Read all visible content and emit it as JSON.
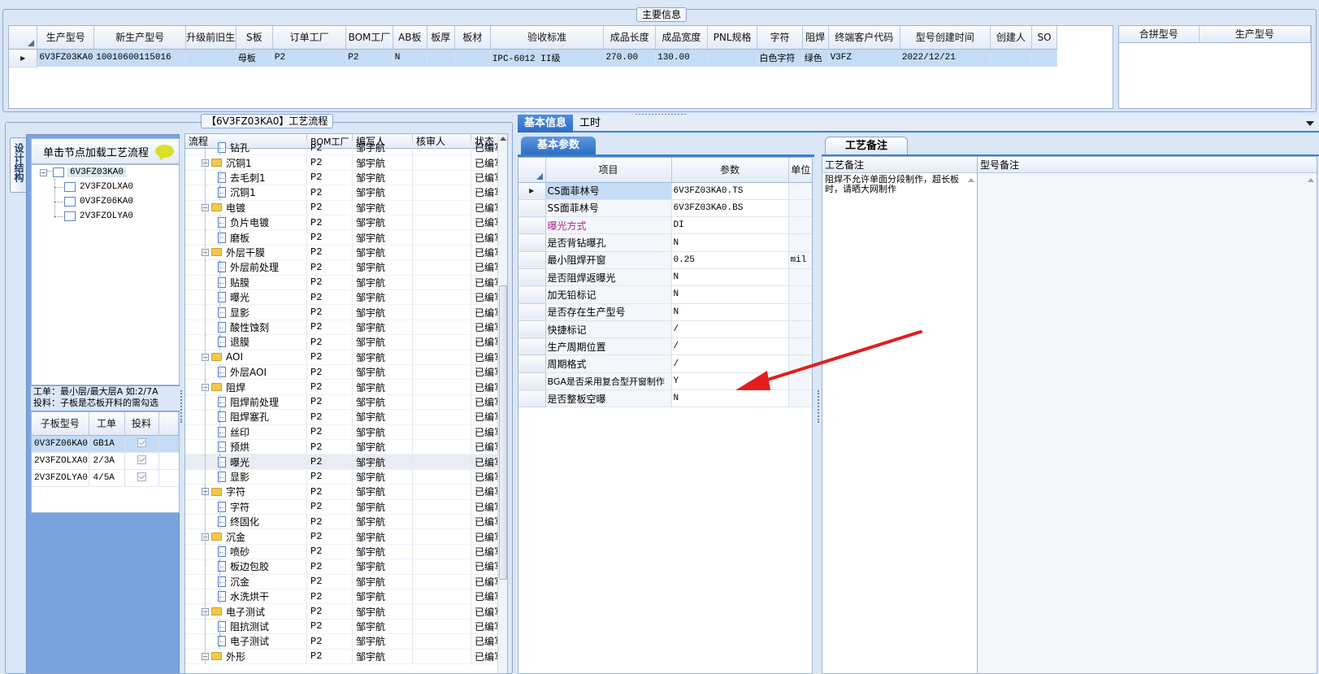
{
  "main_info_title": "主要信息",
  "main_table": {
    "headers": [
      "生产型号",
      "新生产型号",
      "升级前旧生产型号",
      "S板",
      "订单工厂",
      "BOM工厂",
      "AB板",
      "板厚",
      "板材",
      "验收标准",
      "成品长度",
      "成品宽度",
      "PNL规格",
      "字符",
      "阻焊",
      "终端客户代码",
      "型号创建时间",
      "创建人",
      "SO"
    ],
    "row": [
      "6V3FZ03KA0",
      "10010600115016",
      "",
      "母板",
      "P2",
      "P2",
      "N",
      "",
      "",
      "IPC-6012 II级",
      "270.00",
      "130.00",
      "",
      "白色字符",
      "绿色",
      "V3FZ",
      "2022/12/21",
      "",
      ""
    ]
  },
  "merge_table": {
    "headers": [
      "合拼型号",
      "生产型号"
    ]
  },
  "flow_title": "【6V3FZ03KA0】工艺流程",
  "side_tab": "设计结构",
  "structure": {
    "hint": "单击节点加载工艺流程",
    "root": "6V3FZ03KA0",
    "children": [
      "2V3FZOLXA0",
      "0V3FZ06KA0",
      "2V3FZOLYA0"
    ],
    "note1": "工单：最小层/最大层A 如:2/7A",
    "note2": "投料：子板是芯板开料的需勾选",
    "sub_headers": [
      "子板型号",
      "工单",
      "投料"
    ],
    "sub_rows": [
      [
        "0V3FZ06KA0",
        "GB1A"
      ],
      [
        "2V3FZOLXA0",
        "2/3A"
      ],
      [
        "2V3FZOLYA0",
        "4/5A"
      ]
    ]
  },
  "flow": {
    "headers": [
      "流程",
      "BOM工厂",
      "编写人",
      "核审人",
      "状态"
    ],
    "rows": [
      {
        "name": "钻孔",
        "level": 1,
        "folder": false,
        "bom": "P2",
        "writer": "邹宇航",
        "status": "已编写"
      },
      {
        "name": "沉铜1",
        "level": 0,
        "folder": true,
        "bom": "P2",
        "writer": "邹宇航",
        "status": "已编写"
      },
      {
        "name": "去毛刺1",
        "level": 1,
        "folder": false,
        "bom": "P2",
        "writer": "邹宇航",
        "status": "已编写"
      },
      {
        "name": "沉铜1",
        "level": 1,
        "folder": false,
        "bom": "P2",
        "writer": "邹宇航",
        "status": "已编写"
      },
      {
        "name": "电镀",
        "level": 0,
        "folder": true,
        "bom": "P2",
        "writer": "邹宇航",
        "status": "已编写"
      },
      {
        "name": "负片电镀",
        "level": 1,
        "folder": false,
        "bom": "P2",
        "writer": "邹宇航",
        "status": "已编写"
      },
      {
        "name": "磨板",
        "level": 1,
        "folder": false,
        "bom": "P2",
        "writer": "邹宇航",
        "status": "已编写"
      },
      {
        "name": "外层干膜",
        "level": 0,
        "folder": true,
        "bom": "P2",
        "writer": "邹宇航",
        "status": "已编写"
      },
      {
        "name": "外层前处理",
        "level": 1,
        "folder": false,
        "bom": "P2",
        "writer": "邹宇航",
        "status": "已编写"
      },
      {
        "name": "贴膜",
        "level": 1,
        "folder": false,
        "bom": "P2",
        "writer": "邹宇航",
        "status": "已编写"
      },
      {
        "name": "曝光",
        "level": 1,
        "folder": false,
        "bom": "P2",
        "writer": "邹宇航",
        "status": "已编写"
      },
      {
        "name": "显影",
        "level": 1,
        "folder": false,
        "bom": "P2",
        "writer": "邹宇航",
        "status": "已编写"
      },
      {
        "name": "酸性蚀刻",
        "level": 1,
        "folder": false,
        "bom": "P2",
        "writer": "邹宇航",
        "status": "已编写"
      },
      {
        "name": "退膜",
        "level": 1,
        "folder": false,
        "bom": "P2",
        "writer": "邹宇航",
        "status": "已编写"
      },
      {
        "name": "AOI",
        "level": 0,
        "folder": true,
        "bom": "P2",
        "writer": "邹宇航",
        "status": "已编写"
      },
      {
        "name": "外层AOI",
        "level": 1,
        "folder": false,
        "bom": "P2",
        "writer": "邹宇航",
        "status": "已编写"
      },
      {
        "name": "阻焊",
        "level": 0,
        "folder": true,
        "bom": "P2",
        "writer": "邹宇航",
        "status": "已编写"
      },
      {
        "name": "阻焊前处理",
        "level": 1,
        "folder": false,
        "bom": "P2",
        "writer": "邹宇航",
        "status": "已编写"
      },
      {
        "name": "阻焊塞孔",
        "level": 1,
        "folder": false,
        "bom": "P2",
        "writer": "邹宇航",
        "status": "已编写"
      },
      {
        "name": "丝印",
        "level": 1,
        "folder": false,
        "bom": "P2",
        "writer": "邹宇航",
        "status": "已编写"
      },
      {
        "name": "预烘",
        "level": 1,
        "folder": false,
        "bom": "P2",
        "writer": "邹宇航",
        "status": "已编写"
      },
      {
        "name": "曝光",
        "level": 1,
        "folder": false,
        "bom": "P2",
        "writer": "邹宇航",
        "status": "已编写",
        "selected": true
      },
      {
        "name": "显影",
        "level": 1,
        "folder": false,
        "bom": "P2",
        "writer": "邹宇航",
        "status": "已编写"
      },
      {
        "name": "字符",
        "level": 0,
        "folder": true,
        "bom": "P2",
        "writer": "邹宇航",
        "status": "已编写"
      },
      {
        "name": "字符",
        "level": 1,
        "folder": false,
        "bom": "P2",
        "writer": "邹宇航",
        "status": "已编写"
      },
      {
        "name": "终固化",
        "level": 1,
        "folder": false,
        "bom": "P2",
        "writer": "邹宇航",
        "status": "已编写"
      },
      {
        "name": "沉金",
        "level": 0,
        "folder": true,
        "bom": "P2",
        "writer": "邹宇航",
        "status": "已编写"
      },
      {
        "name": "喷砂",
        "level": 1,
        "folder": false,
        "bom": "P2",
        "writer": "邹宇航",
        "status": "已编写"
      },
      {
        "name": "板边包胶",
        "level": 1,
        "folder": false,
        "bom": "P2",
        "writer": "邹宇航",
        "status": "已编写"
      },
      {
        "name": "沉金",
        "level": 1,
        "folder": false,
        "bom": "P2",
        "writer": "邹宇航",
        "status": "已编写"
      },
      {
        "name": "水洗烘干",
        "level": 1,
        "folder": false,
        "bom": "P2",
        "writer": "邹宇航",
        "status": "已编写"
      },
      {
        "name": "电子测试",
        "level": 0,
        "folder": true,
        "bom": "P2",
        "writer": "邹宇航",
        "status": "已编写"
      },
      {
        "name": "阻抗测试",
        "level": 1,
        "folder": false,
        "bom": "P2",
        "writer": "邹宇航",
        "status": "已编写"
      },
      {
        "name": "电子测试",
        "level": 1,
        "folder": false,
        "bom": "P2",
        "writer": "邹宇航",
        "status": "已编写"
      },
      {
        "name": "外形",
        "level": 0,
        "folder": true,
        "bom": "P2",
        "writer": "邹宇航",
        "status": "已编写"
      }
    ]
  },
  "tabs": {
    "basic": "基本信息",
    "hours": "工时"
  },
  "basic_params": {
    "tab": "基本参数",
    "headers": [
      "项目",
      "参数",
      "单位"
    ],
    "rows": [
      {
        "item": "CS面菲林号",
        "value": "6V3FZ03KA0.TS",
        "unit": "",
        "selected": true
      },
      {
        "item": "SS面菲林号",
        "value": "6V3FZ03KA0.BS",
        "unit": ""
      },
      {
        "item": "曝光方式",
        "value": "DI",
        "unit": "",
        "color": "#b0238f"
      },
      {
        "item": "是否背钻曝孔",
        "value": "N",
        "unit": ""
      },
      {
        "item": "最小阻焊开窗",
        "value": "0.25",
        "unit": "mil"
      },
      {
        "item": "是否阻焊返曝光",
        "value": "N",
        "unit": ""
      },
      {
        "item": "加无铅标记",
        "value": "N",
        "unit": ""
      },
      {
        "item": "是否存在生产型号",
        "value": "N",
        "unit": ""
      },
      {
        "item": "快捷标记",
        "value": "/",
        "unit": ""
      },
      {
        "item": "生产周期位置",
        "value": "/",
        "unit": ""
      },
      {
        "item": "周期格式",
        "value": "/",
        "unit": ""
      },
      {
        "item": "BGA是否采用复合型开窗制作",
        "value": "Y",
        "unit": ""
      },
      {
        "item": "是否整板空曝",
        "value": "N",
        "unit": ""
      }
    ]
  },
  "process_notes": {
    "tab": "工艺备注",
    "col1": "工艺备注",
    "col2": "型号备注",
    "text": "阻焊不允许单面分段制作，超长板时，请晒大网制作"
  },
  "colors": {
    "selected_row": "#c5dcf6",
    "arrow": "#e31c1c"
  }
}
